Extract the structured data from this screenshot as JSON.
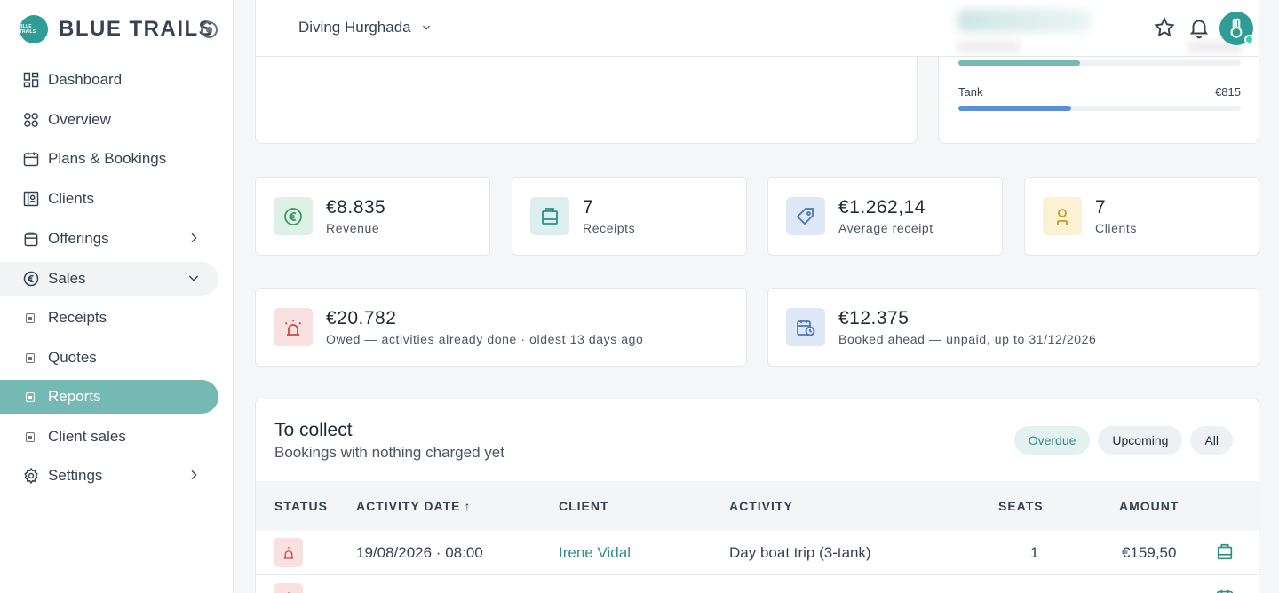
{
  "brand": {
    "name": "BLUE TRAILS",
    "logo_text": "BLUE TRAILS"
  },
  "sidebar": {
    "items": [
      {
        "label": "Dashboard",
        "icon": "dashboard-icon"
      },
      {
        "label": "Overview",
        "icon": "overview-icon"
      },
      {
        "label": "Plans & Bookings",
        "icon": "calendar-icon"
      },
      {
        "label": "Clients",
        "icon": "clients-icon"
      },
      {
        "label": "Offerings",
        "icon": "offerings-icon"
      },
      {
        "label": "Sales",
        "icon": "euro-icon"
      },
      {
        "label": "Settings",
        "icon": "gear-icon"
      }
    ],
    "sales_children": [
      {
        "label": "Receipts"
      },
      {
        "label": "Quotes"
      },
      {
        "label": "Reports",
        "active": true
      },
      {
        "label": "Client sales"
      }
    ]
  },
  "header": {
    "location": "Diving Hurghada"
  },
  "breakdown": {
    "rows": [
      {
        "label": "",
        "value": "",
        "fraction": 0.43,
        "color": "#74b9b2"
      },
      {
        "label": "Tank",
        "value": "€815",
        "fraction": 0.4,
        "color": "#5b8fd6"
      }
    ]
  },
  "stats": [
    {
      "value": "€8.835",
      "label": "Revenue",
      "icon": "euro-icon",
      "tone": "green"
    },
    {
      "value": "7",
      "label": "Receipts",
      "icon": "receipt-icon",
      "tone": "teal"
    },
    {
      "value": "€1.262,14",
      "label": "Average receipt",
      "icon": "tag-icon",
      "tone": "blue"
    },
    {
      "value": "7",
      "label": "Clients",
      "icon": "client-icon",
      "tone": "yellow"
    },
    {
      "value": "€20.782",
      "label": "Owed — activities already done · oldest 13 days ago",
      "icon": "alarm-icon",
      "tone": "red"
    },
    {
      "value": "€12.375",
      "label": "Booked ahead — unpaid, up to 31/12/2026",
      "icon": "calendar-clock-icon",
      "tone": "blue"
    }
  ],
  "collect": {
    "title": "To collect",
    "subtitle": "Bookings with nothing charged yet",
    "filters": [
      {
        "label": "Overdue",
        "active": true
      },
      {
        "label": "Upcoming",
        "active": false
      },
      {
        "label": "All",
        "active": false
      }
    ],
    "columns": {
      "status": "STATUS",
      "activity_date": "ACTIVITY DATE",
      "client": "CLIENT",
      "activity": "ACTIVITY",
      "seats": "SEATS",
      "amount": "AMOUNT"
    },
    "rows": [
      {
        "date": "19/08/2026 · 08:00",
        "client": "Irene Vidal",
        "activity": "Day boat trip (3-tank)",
        "seats": "1",
        "amount": "€159,50"
      },
      {
        "date": "",
        "client": "",
        "activity": "",
        "seats": "",
        "amount": ""
      }
    ]
  },
  "colors": {
    "accent": "#2f9d96",
    "active_nav": "#74b9b2",
    "link": "#2f8f88"
  }
}
